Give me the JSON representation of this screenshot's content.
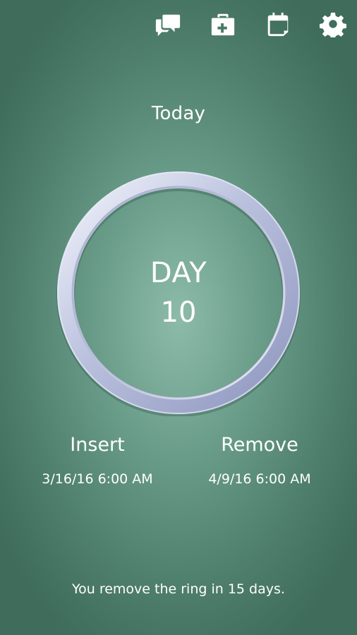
{
  "header": {
    "actions": [
      {
        "icon": "chat-bubbles-icon"
      },
      {
        "icon": "first-aid-kit-icon"
      },
      {
        "icon": "calendar-icon"
      },
      {
        "icon": "gear-icon"
      }
    ]
  },
  "main": {
    "today_label": "Today",
    "day_label": "DAY",
    "day_number": "10"
  },
  "insert": {
    "label": "Insert",
    "datetime": "3/16/16 6:00 AM"
  },
  "remove": {
    "label": "Remove",
    "datetime": "4/9/16 6:00 AM"
  },
  "footer": {
    "message": "You remove the ring in 15 days."
  },
  "colors": {
    "background_center": "#8dbba9",
    "background_edge": "#3f6c5b",
    "ring": "#c7cde6",
    "text": "#ffffff"
  }
}
